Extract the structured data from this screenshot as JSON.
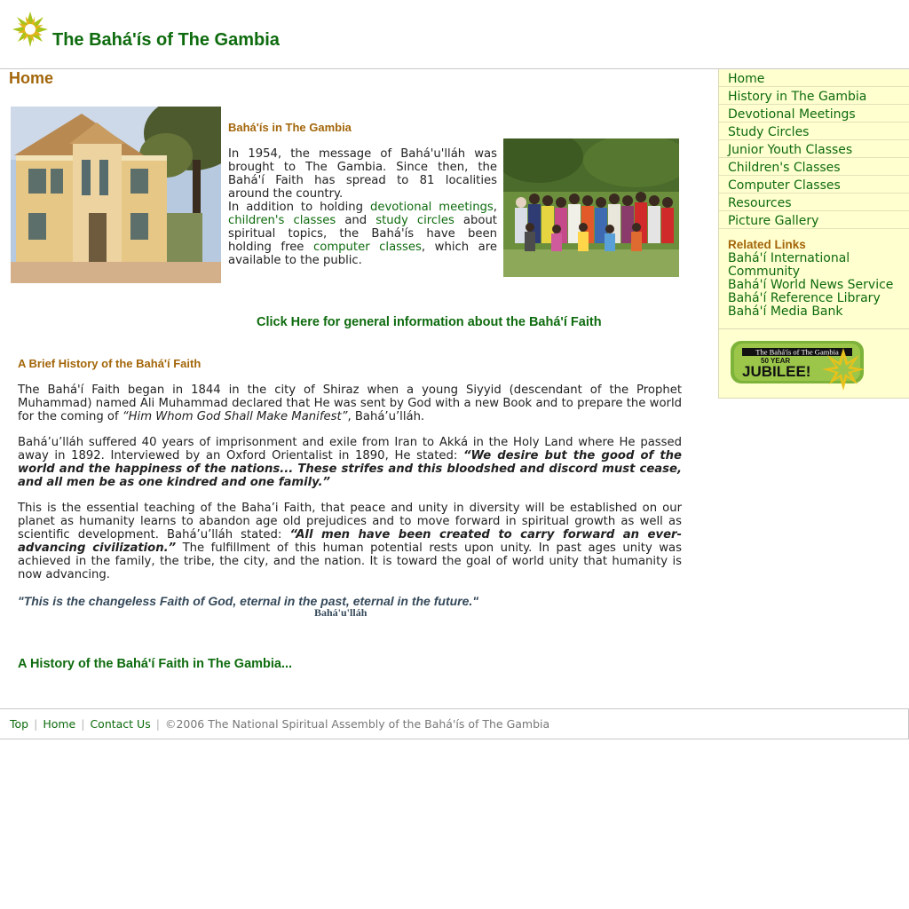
{
  "header": {
    "site_title": "The Bahá'ís of The Gambia",
    "logo_icon": "nine-pointed-star-icon"
  },
  "main": {
    "page_heading": "Home",
    "intro": {
      "title": "Bahá'ís in The Gambia",
      "p1": "In 1954, the message of Bahá'u'lláh was brought to The Gambia. Since then, the Bahá'í Faith has spread to 81 localities around the country.",
      "p2_start": "In addition to holding",
      "link_devotional": "devotional meetings",
      "comma1": ",",
      "link_childrens": "children's classes",
      "and": "and",
      "link_study": "study circles",
      "p2_mid": "about spiritual topics, the Bahá'ís have been holding free",
      "link_computer": "computer classes",
      "p2_end": ", which are available to the public."
    },
    "general_info_link": "Click Here for general information about the Bahá'í Faith",
    "history": {
      "title": "A Brief History of the Bahá'í Faith",
      "p1a": "The  Bahá'í Faith began in 1844 in the city of Shiraz when a young Siyyid  (descendant of the Prophet Muhammad) named Ali Muhammad declared that He was  sent by God with a new Book and to prepare the world for the coming of ",
      "p1_quote": "“Him  Whom God Shall Make Manifest”",
      "p1b": ", Bahá’u’lláh.",
      "p2a": "Bahá’u’lláh suffered 40 years of imprisonment and exile from Iran to Akká in the Holy Land where He passed away in 1892.  Interviewed by an Oxford Orientalist in 1890, He stated: ",
      "p2_quote": "“We desire but the good of the world and the  happiness of the nations... These strifes and this bloodshed and discord must cease, and all men be as one kindred and one family.”",
      "p3a": "This is the essential teaching of the Baha’i Faith, that peace and unity in diversity will be established on our planet as humanity learns to abandon age old prejudices and to move forward in spiritual growth as well as scientific development.   Bahá’u’lláh stated: ",
      "p3_quote": "“All men have been created to carry forward an ever-advancing civilization.”",
      "p3b": "  The fulfillment of this human potential rests upon unity.  In past ages unity was achieved in the family, the tribe, the city, and the nation.  It is toward the goal of world unity that humanity is now advancing.",
      "closing_quote": "\"This is the changeless Faith of God, eternal in the past, eternal in the future.\"",
      "closing_attribution": "Bahá'u'lláh"
    },
    "history_link": "A History of the Bahá'í Faith in The Gambia..."
  },
  "sidebar": {
    "nav": [
      {
        "label": "Home"
      },
      {
        "label": "History in The Gambia"
      },
      {
        "label": "Devotional Meetings"
      },
      {
        "label": "Study Circles"
      },
      {
        "label": "Junior Youth Classes"
      },
      {
        "label": "Children's Classes"
      },
      {
        "label": "Computer Classes"
      },
      {
        "label": "Resources"
      },
      {
        "label": "Picture Gallery"
      }
    ],
    "related_title": "Related Links",
    "related": [
      {
        "label": "Bahá'í International Community"
      },
      {
        "label": "Bahá'í World News Service"
      },
      {
        "label": "Bahá'í Reference Library"
      },
      {
        "label": "Bahá'í Media Bank"
      }
    ],
    "banner": {
      "line1": "The Bahá'ís of The Gambia",
      "line2": "50 YEAR",
      "line3": "JUBILEE!"
    }
  },
  "footer": {
    "top": "Top",
    "sep": "|",
    "home": "Home",
    "contact": "Contact Us",
    "copyright": "©2006 The National Spiritual Assembly of the Bahá'ís of The Gambia"
  },
  "colors": {
    "link_green": "#0e6b0e",
    "heading_brown": "#a3660a",
    "sidebar_bg": "#ffffcf",
    "quote_slate": "#35495a"
  }
}
